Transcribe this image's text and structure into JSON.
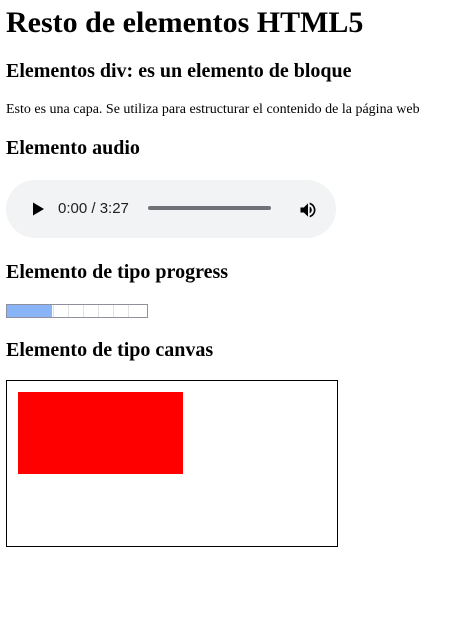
{
  "headings": {
    "title": "Resto de elementos HTML5",
    "div": "Elementos div: es un elemento de bloque",
    "audio": "Elemento audio",
    "progress": "Elemento de tipo progress",
    "canvas": "Elemento de tipo canvas"
  },
  "div_text": "Esto es una capa. Se utiliza para estructurar el contenido de la página web",
  "audio": {
    "time": "0:00 / 3:27",
    "play_icon": "play-icon",
    "volume_icon": "volume-icon"
  },
  "progress": {
    "value_fraction": 0.32,
    "fill_color": "#8ab4f8"
  },
  "canvas": {
    "rect_color": "#ff0000"
  }
}
